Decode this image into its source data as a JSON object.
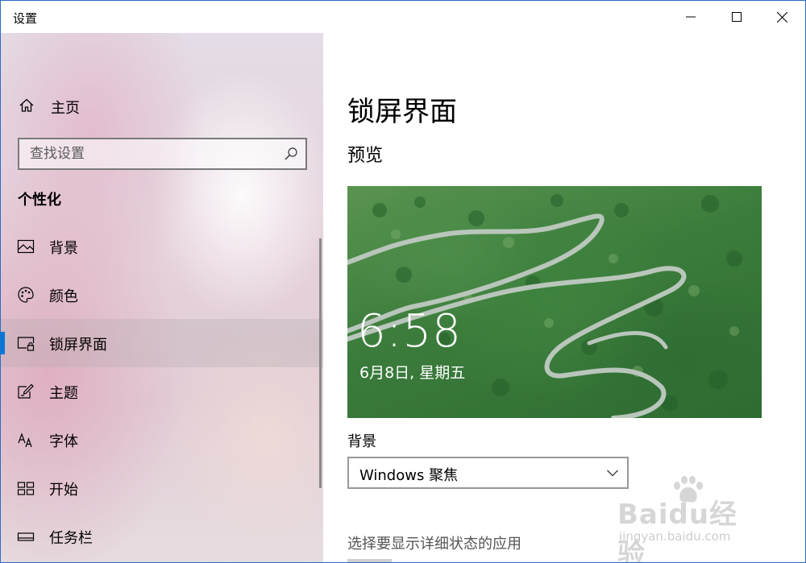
{
  "window": {
    "title": "设置"
  },
  "sidebar": {
    "home_label": "主页",
    "search_placeholder": "查找设置",
    "section_title": "个性化",
    "items": [
      {
        "label": "背景",
        "icon": "picture-icon"
      },
      {
        "label": "颜色",
        "icon": "palette-icon"
      },
      {
        "label": "锁屏界面",
        "icon": "lock-screen-icon",
        "selected": true
      },
      {
        "label": "主题",
        "icon": "theme-brush-icon"
      },
      {
        "label": "字体",
        "icon": "font-icon"
      },
      {
        "label": "开始",
        "icon": "start-grid-icon"
      },
      {
        "label": "任务栏",
        "icon": "taskbar-icon"
      }
    ]
  },
  "main": {
    "page_title": "锁屏界面",
    "preview_title": "预览",
    "preview": {
      "time": "6:58",
      "date": "6月8日, 星期五"
    },
    "background_label": "背景",
    "background_value": "Windows 聚焦",
    "detail_status_label": "选择要显示详细状态的应用"
  },
  "watermark": {
    "brand": "Baidu经验",
    "url": "jingyan.baidu.com"
  },
  "colors": {
    "accent": "#0078d7",
    "window_border": "#2b6cc4"
  }
}
